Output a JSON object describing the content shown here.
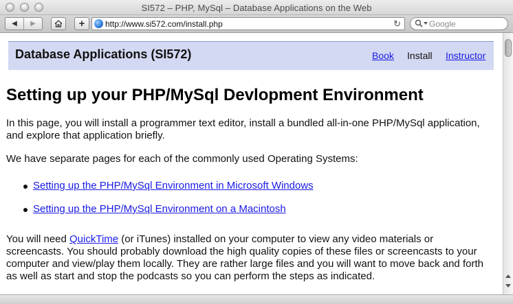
{
  "window": {
    "title": "SI572 – PHP, MySql – Database Applications on the Web"
  },
  "toolbar": {
    "back_icon": "back-arrow-icon",
    "forward_icon": "forward-arrow-icon",
    "home_icon": "home-icon",
    "add_label": "+",
    "url": "http://www.si572.com/install.php",
    "reload_icon": "reload-icon",
    "search_placeholder": "Google"
  },
  "page": {
    "header": {
      "site_title": "Database Applications (SI572)",
      "nav": [
        {
          "label": "Book",
          "link": true
        },
        {
          "label": "Install",
          "link": false
        },
        {
          "label": "Instructor",
          "link": true
        }
      ],
      "band_color": "#d3d9f2"
    },
    "title": "Setting up your PHP/MySql Devlopment Environment",
    "intro": "In this page, you will install a programmer text editor, install a bundled all-in-one PHP/MySql application, and explore that application briefly.",
    "os_intro": "We have separate pages for each of the commonly used Operating Systems:",
    "links": [
      "Setting up the PHP/MySql Environment in Microsoft Windows",
      "Setting up the PHP/MySql Environment on a Macintosh"
    ],
    "video_para": {
      "before": "You will need ",
      "link": "QuickTime",
      "after": " (or iTunes) installed on your computer to view any video materials or screencasts. You should probably download the high quality copies of these files or screencasts to your computer and view/play them locally. They are rather large files and you will want to move back and forth as well as start and stop the podcasts so you can perform the steps as indicated."
    },
    "link_color": "#1a1ae6"
  }
}
